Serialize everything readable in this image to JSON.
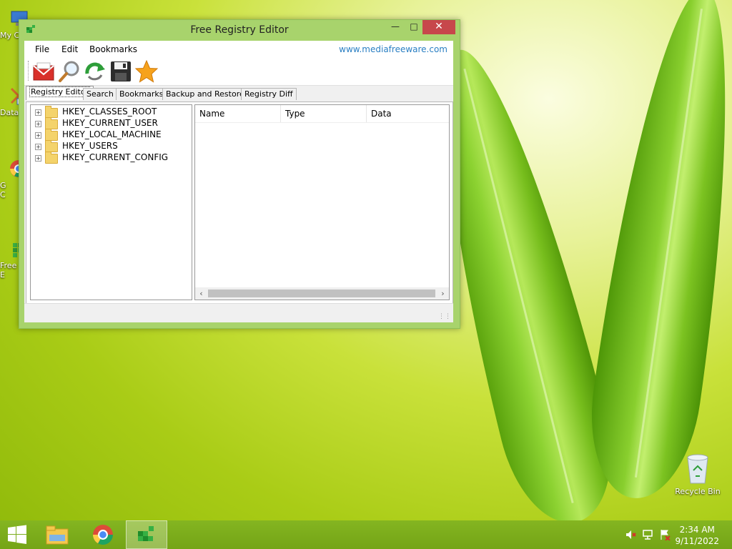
{
  "desktop": {
    "icons": [
      {
        "label": "My C"
      },
      {
        "label": "Data"
      },
      {
        "label": "G\nC"
      },
      {
        "label": "Free\nE"
      }
    ],
    "recycle_bin": "Recycle Bin"
  },
  "window": {
    "title": "Free Registry Editor",
    "controls": {
      "minimize": "—",
      "maximize": "□",
      "close": "✕"
    },
    "menu": [
      "File",
      "Edit",
      "Bookmarks"
    ],
    "url": "www.mediafreeware.com",
    "toolbar": [
      {
        "icon": "mail-icon"
      },
      {
        "icon": "search-icon"
      },
      {
        "icon": "refresh-icon"
      },
      {
        "icon": "save-icon"
      },
      {
        "icon": "star-icon"
      }
    ],
    "tabs": [
      "Registry Editor",
      "Search",
      "Bookmarks",
      "Backup and Restore",
      "Registry Diff"
    ],
    "active_tab": "Registry Editor",
    "tree": [
      "HKEY_CLASSES_ROOT",
      "HKEY_CURRENT_USER",
      "HKEY_LOCAL_MACHINE",
      "HKEY_USERS",
      "HKEY_CURRENT_CONFIG"
    ],
    "columns": [
      "Name",
      "Type",
      "Data"
    ]
  },
  "taskbar": {
    "time": "2:34 AM",
    "date": "9/11/2022"
  },
  "colors": {
    "accent_green": "#84b521",
    "close_red": "#c7474b",
    "link_blue": "#2a7fc3"
  }
}
